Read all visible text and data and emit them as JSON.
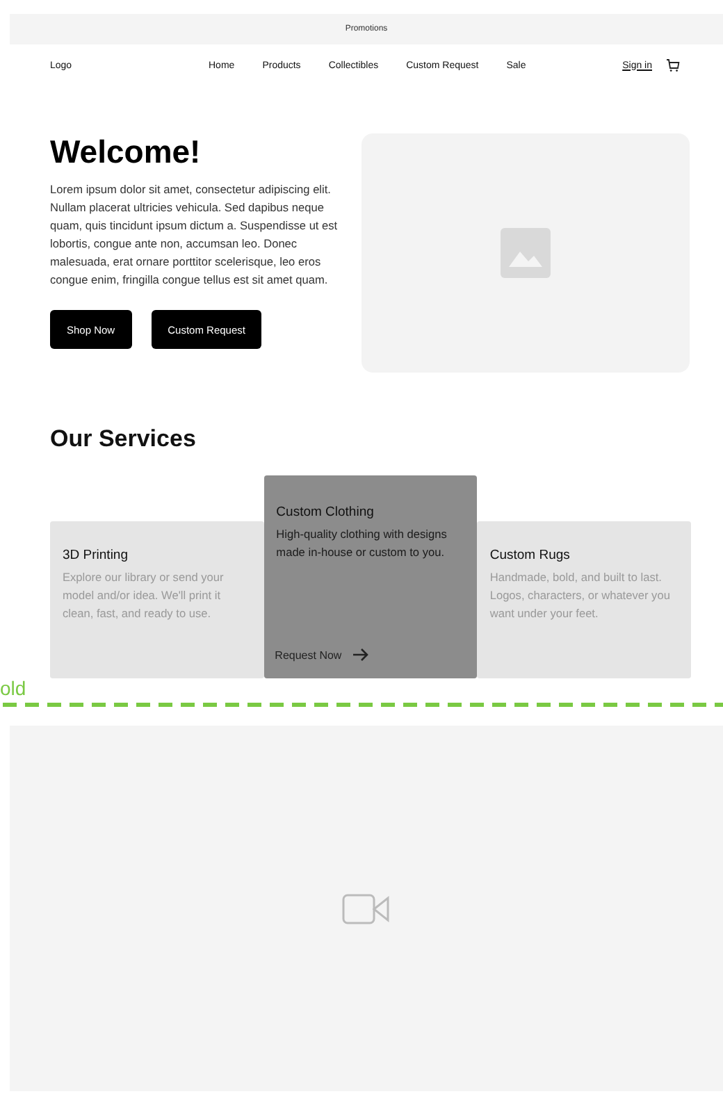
{
  "promo_bar": {
    "text": "Promotions"
  },
  "nav": {
    "logo": "Logo",
    "links": [
      "Home",
      "Products",
      "Collectibles",
      "Custom Request",
      "Sale"
    ],
    "sign_in": "Sign in"
  },
  "hero": {
    "title": "Welcome!",
    "body": "Lorem ipsum dolor sit amet, consectetur adipiscing elit. Nullam placerat ultricies vehicula. Sed dapibus neque quam, quis tincidunt ipsum dictum a. Suspendisse ut est lobortis, congue ante non, accumsan leo. Donec malesuada, erat ornare porttitor scelerisque, leo eros congue enim, fringilla congue tellus est sit amet quam.",
    "buttons": [
      "Shop Now",
      "Custom Request"
    ]
  },
  "services": {
    "title": "Our Services",
    "cards": [
      {
        "title": "3D Printing",
        "text": "Explore our library or send your model and/or idea. We'll print it clean, fast, and ready to use.",
        "highlighted": false
      },
      {
        "title": "Custom Clothing",
        "text": "High-quality clothing with designs made in-house or custom to you.",
        "highlighted": true,
        "link": "Request Now"
      },
      {
        "title": "Custom Rugs",
        "text": "Handmade, bold, and built to last. Logos, characters, or whatever you want under your feet.",
        "highlighted": false
      }
    ]
  },
  "fold_marker": {
    "label": "old"
  },
  "video": {
    "kind": "video-placeholder"
  }
}
